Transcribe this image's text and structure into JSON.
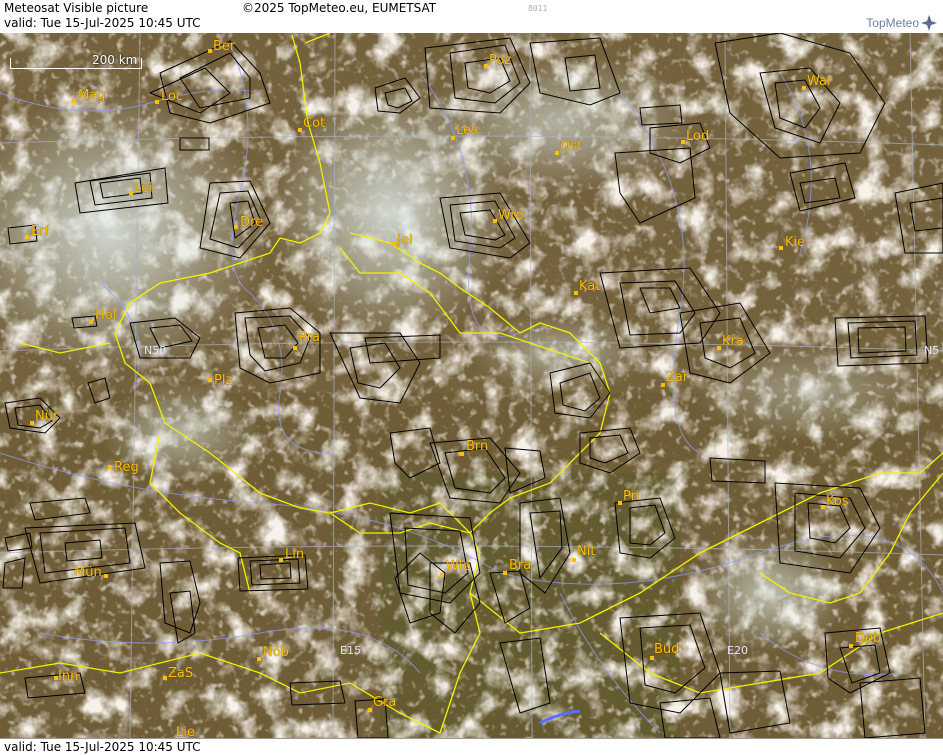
{
  "header": {
    "title": "Meteosat Visible picture",
    "valid": "valid:  Tue  15-Jul-2025  10:45 UTC",
    "copyright": "©2025 TopMeteo.eu, EUMETSAT",
    "code": "8011",
    "brand": "TopMeteo"
  },
  "footer": {
    "valid": "valid:  Tue  15-Jul-2025  10:45 UTC"
  },
  "scale": {
    "label": "200 km"
  },
  "grid_labels": {
    "n50_left": "N50",
    "n50_right": "N5",
    "e15": "E15",
    "e20": "E20"
  },
  "colors": {
    "city": "#ffc000",
    "border": "#f2f200",
    "grid": "#a9b2c9",
    "river": "#8f9cff",
    "zone": "#000000"
  },
  "cities": [
    {
      "name": "Ber"
    },
    {
      "name": "Mag"
    },
    {
      "name": "Loc"
    },
    {
      "name": "Cot"
    },
    {
      "name": "Poz"
    },
    {
      "name": "War"
    },
    {
      "name": "Les"
    },
    {
      "name": "Ost"
    },
    {
      "name": "Lod"
    },
    {
      "name": "Lei"
    },
    {
      "name": "Erf"
    },
    {
      "name": "Dre"
    },
    {
      "name": "Wro"
    },
    {
      "name": "Jel"
    },
    {
      "name": "Kie"
    },
    {
      "name": "Kat"
    },
    {
      "name": "Hof"
    },
    {
      "name": "Pra"
    },
    {
      "name": "Kra"
    },
    {
      "name": "Plz"
    },
    {
      "name": "Zar"
    },
    {
      "name": "Nür"
    },
    {
      "name": "Brn"
    },
    {
      "name": "Reg"
    },
    {
      "name": "Pri"
    },
    {
      "name": "Kos"
    },
    {
      "name": "Lin"
    },
    {
      "name": "Nit"
    },
    {
      "name": "Wie"
    },
    {
      "name": "Bra"
    },
    {
      "name": "Mün"
    },
    {
      "name": "Bud"
    },
    {
      "name": "Nöb"
    },
    {
      "name": "Deb"
    },
    {
      "name": "Inn"
    },
    {
      "name": "ZaS"
    },
    {
      "name": "Gra"
    },
    {
      "name": "Lie"
    }
  ]
}
